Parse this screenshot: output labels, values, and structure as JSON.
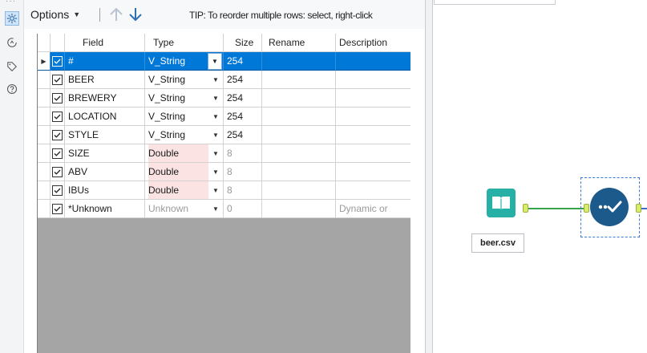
{
  "toolbar": {
    "options_label": "Options",
    "tip_text": "TIP: To reorder multiple rows: select, right-click"
  },
  "grid": {
    "columns": [
      "Field",
      "Type",
      "Size",
      "Rename",
      "Description"
    ],
    "rows": [
      {
        "field": "#",
        "type": "V_String",
        "size": "254",
        "rename": "",
        "description": "",
        "checked": true,
        "selected": true,
        "fixed_type": false
      },
      {
        "field": "BEER",
        "type": "V_String",
        "size": "254",
        "rename": "",
        "description": "",
        "checked": true,
        "selected": false,
        "fixed_type": false
      },
      {
        "field": "BREWERY",
        "type": "V_String",
        "size": "254",
        "rename": "",
        "description": "",
        "checked": true,
        "selected": false,
        "fixed_type": false
      },
      {
        "field": "LOCATION",
        "type": "V_String",
        "size": "254",
        "rename": "",
        "description": "",
        "checked": true,
        "selected": false,
        "fixed_type": false
      },
      {
        "field": "STYLE",
        "type": "V_String",
        "size": "254",
        "rename": "",
        "description": "",
        "checked": true,
        "selected": false,
        "fixed_type": false
      },
      {
        "field": "SIZE",
        "type": "Double",
        "size": "8",
        "rename": "",
        "description": "",
        "checked": true,
        "selected": false,
        "fixed_type": true
      },
      {
        "field": "ABV",
        "type": "Double",
        "size": "8",
        "rename": "",
        "description": "",
        "checked": true,
        "selected": false,
        "fixed_type": true
      },
      {
        "field": "IBUs",
        "type": "Double",
        "size": "8",
        "rename": "",
        "description": "",
        "checked": true,
        "selected": false,
        "fixed_type": true
      },
      {
        "field": "*Unknown",
        "type": "Unknown",
        "size": "0",
        "rename": "",
        "description": "Dynamic or",
        "checked": true,
        "selected": false,
        "fixed_type": false,
        "unknown": true
      }
    ]
  },
  "canvas": {
    "input_node_label": "beer.csv"
  },
  "colors": {
    "selection": "#0078d7",
    "input_node": "#27b0a5",
    "select_node": "#1d5a8c",
    "connection": "#37a34a",
    "fixed_type_bg": "#fbe3e3"
  },
  "icons": {
    "sidebar": [
      "gear-icon",
      "rotate-icon",
      "tag-icon",
      "help-icon"
    ],
    "toolbar": [
      "move-up-icon",
      "move-down-icon"
    ]
  }
}
